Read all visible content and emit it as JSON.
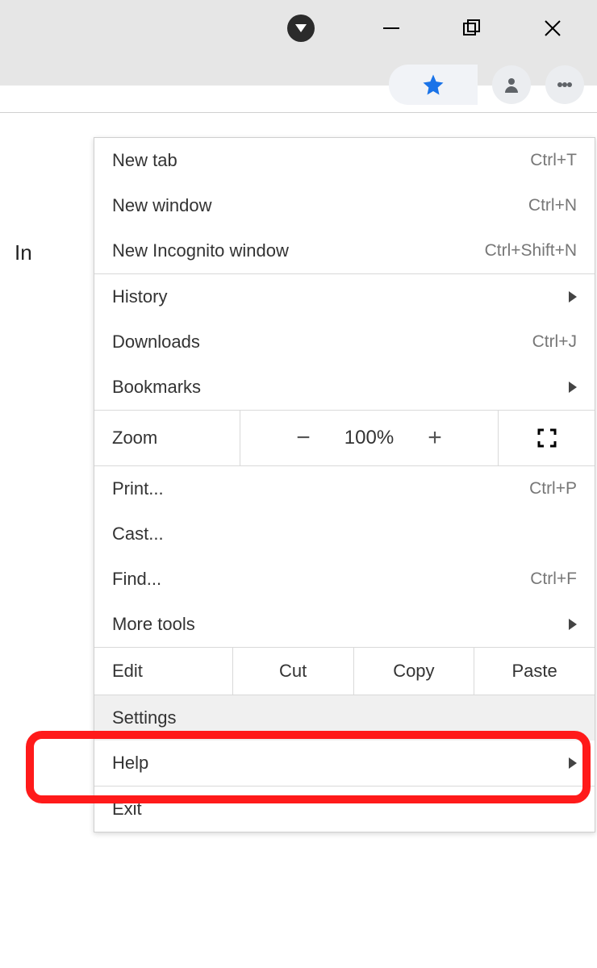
{
  "page_hint": "In",
  "menu": {
    "new_tab": {
      "label": "New tab",
      "shortcut": "Ctrl+T"
    },
    "new_window": {
      "label": "New window",
      "shortcut": "Ctrl+N"
    },
    "new_incognito": {
      "label": "New Incognito window",
      "shortcut": "Ctrl+Shift+N"
    },
    "history": {
      "label": "History"
    },
    "downloads": {
      "label": "Downloads",
      "shortcut": "Ctrl+J"
    },
    "bookmarks": {
      "label": "Bookmarks"
    },
    "zoom": {
      "label": "Zoom",
      "minus": "−",
      "level": "100%",
      "plus": "+"
    },
    "print": {
      "label": "Print...",
      "shortcut": "Ctrl+P"
    },
    "cast": {
      "label": "Cast..."
    },
    "find": {
      "label": "Find...",
      "shortcut": "Ctrl+F"
    },
    "more_tools": {
      "label": "More tools"
    },
    "edit": {
      "label": "Edit",
      "cut": "Cut",
      "copy": "Copy",
      "paste": "Paste"
    },
    "settings": {
      "label": "Settings"
    },
    "help": {
      "label": "Help"
    },
    "exit": {
      "label": "Exit"
    }
  }
}
